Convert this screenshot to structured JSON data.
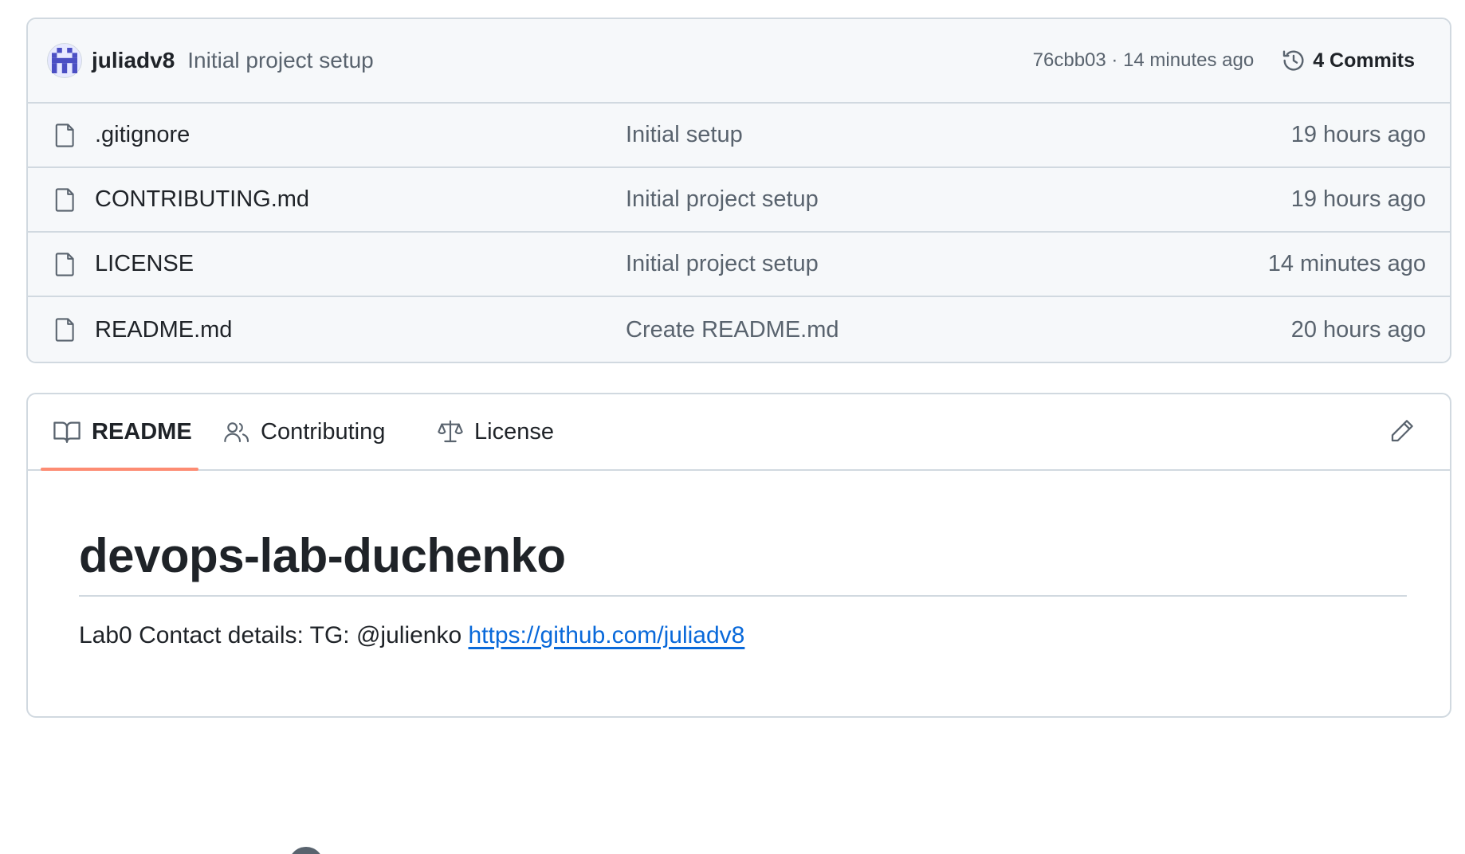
{
  "latest_commit": {
    "author": "juliadv8",
    "message": "Initial project setup",
    "meta": "76cbb03 · 14 minutes ago",
    "commits_label": "4 Commits",
    "history_icon": "history-icon",
    "avatar_icon": "identicon-avatar"
  },
  "files": [
    {
      "name": ".gitignore",
      "commit": "Initial setup",
      "time": "19 hours ago",
      "icon": "file-icon"
    },
    {
      "name": "CONTRIBUTING.md",
      "commit": "Initial project setup",
      "time": "19 hours ago",
      "icon": "file-icon"
    },
    {
      "name": "LICENSE",
      "commit": "Initial project setup",
      "time": "14 minutes ago",
      "icon": "file-icon"
    },
    {
      "name": "README.md",
      "commit": "Create README.md",
      "time": "20 hours ago",
      "icon": "file-icon"
    }
  ],
  "readme_tabs": [
    {
      "label": "README",
      "icon": "book-icon",
      "active": true
    },
    {
      "label": "Contributing",
      "icon": "people-icon",
      "active": false
    },
    {
      "label": "License",
      "icon": "law-icon",
      "active": false
    }
  ],
  "readme": {
    "title": "devops-lab-duchenko",
    "text": "Lab0 Contact details: TG: @julienko ",
    "link_text": "https://github.com/juliadv8",
    "link_href": "https://github.com/juliadv8",
    "edit_icon": "pencil-icon"
  },
  "colors": {
    "accent_underline": "#fd8c73",
    "link": "#0969da",
    "muted_text": "#59636e",
    "border": "#d1d9e0",
    "header_bg": "#f6f8fa"
  }
}
